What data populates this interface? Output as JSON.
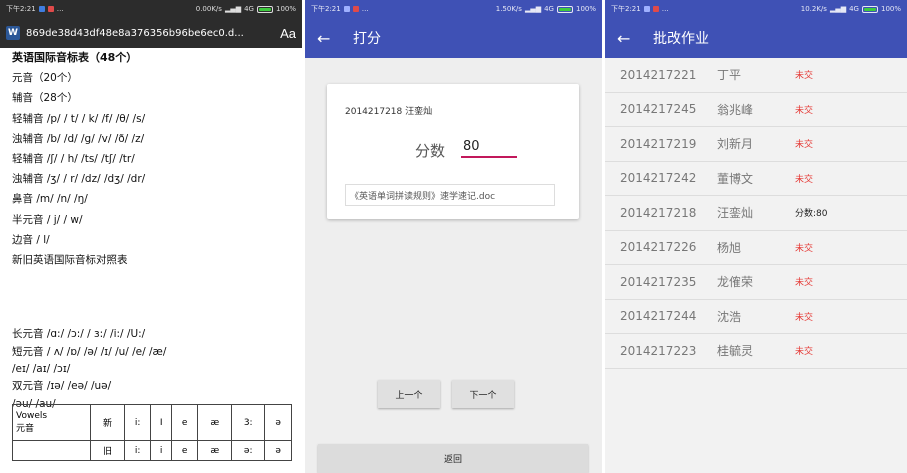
{
  "status_bars": [
    {
      "time": "下午2:21",
      "speed": "0.00K/s",
      "network": "4G",
      "battery": "100%"
    },
    {
      "time": "下午2:21",
      "speed": "1.50K/s",
      "network": "4G",
      "battery": "100%"
    },
    {
      "time": "下午2:21",
      "speed": "10.2K/s",
      "network": "4G",
      "battery": "100%"
    }
  ],
  "colors": {
    "primary": "#3f51b5",
    "late": "#e53935",
    "accent": "#c2185b",
    "battery": "#3ecb3e"
  },
  "doc_viewer": {
    "file_name": "869de38d43df48e8a376356b96be6ec0.d...",
    "font_button": "Aa",
    "lines": [
      "英语国际音标表（48个）",
      "元音（20个）",
      "辅音（28个）",
      "轻辅音 /p/ / t/ / k/ /f/ /θ/ /s/",
      "浊辅音 /b/ /d/ /g/ /v/ /ð/ /z/",
      "轻辅音 /ʃ/ / h/ /ts/ /tʃ/ /tr/",
      "浊辅音 /ʒ/ / r/ /dz/ /dʒ/ /dr/",
      "鼻音 /m/ /n/ /ŋ/",
      "半元音 / j/ / w/",
      "边音 / l/",
      "新旧英语国际音标对照表"
    ],
    "lines2": [
      "长元音 /ɑ:/ /ɔ:/ / ɜ:/ /i:/ /U:/",
      "短元音 / ʌ/ /ɒ/ /ə/ /ɪ/ /u/ /e/ /æ/",
      "/eɪ/ /aɪ/ /ɔɪ/",
      "双元音 /ɪə/ /eə/ /uə/",
      "/əu/ /au/"
    ],
    "table": {
      "header": [
        "Vowels",
        "元音"
      ],
      "row1": [
        "新",
        "i:",
        "I",
        "e",
        "æ",
        "3:",
        "ə"
      ],
      "row2": [
        "旧",
        "i:",
        "i",
        "e",
        "æ",
        "ə:",
        "ə"
      ]
    }
  },
  "grading": {
    "title": "打分",
    "student": "2014217218 汪銮灿",
    "score_label": "分数",
    "score_value": "80",
    "file_name": "《英语单词拼读规则》速学速记.doc",
    "prev_label": "上一个",
    "next_label": "下一个",
    "return_label": "返回"
  },
  "homework": {
    "title": "批改作业",
    "rows": [
      {
        "id": "2014217221",
        "name": "丁平",
        "status": "未交",
        "submitted": false
      },
      {
        "id": "2014217245",
        "name": "翁兆峰",
        "status": "未交",
        "submitted": false
      },
      {
        "id": "2014217219",
        "name": "刘新月",
        "status": "未交",
        "submitted": false
      },
      {
        "id": "2014217242",
        "name": "董博文",
        "status": "未交",
        "submitted": false
      },
      {
        "id": "2014217218",
        "name": "汪銮灿",
        "status": "分数:80",
        "submitted": true
      },
      {
        "id": "2014217226",
        "name": "杨旭",
        "status": "未交",
        "submitted": false
      },
      {
        "id": "2014217235",
        "name": "龙傕荣",
        "status": "未交",
        "submitted": false
      },
      {
        "id": "2014217244",
        "name": "沈浩",
        "status": "未交",
        "submitted": false
      },
      {
        "id": "2014217223",
        "name": "桂毓灵",
        "status": "未交",
        "submitted": false
      }
    ]
  }
}
